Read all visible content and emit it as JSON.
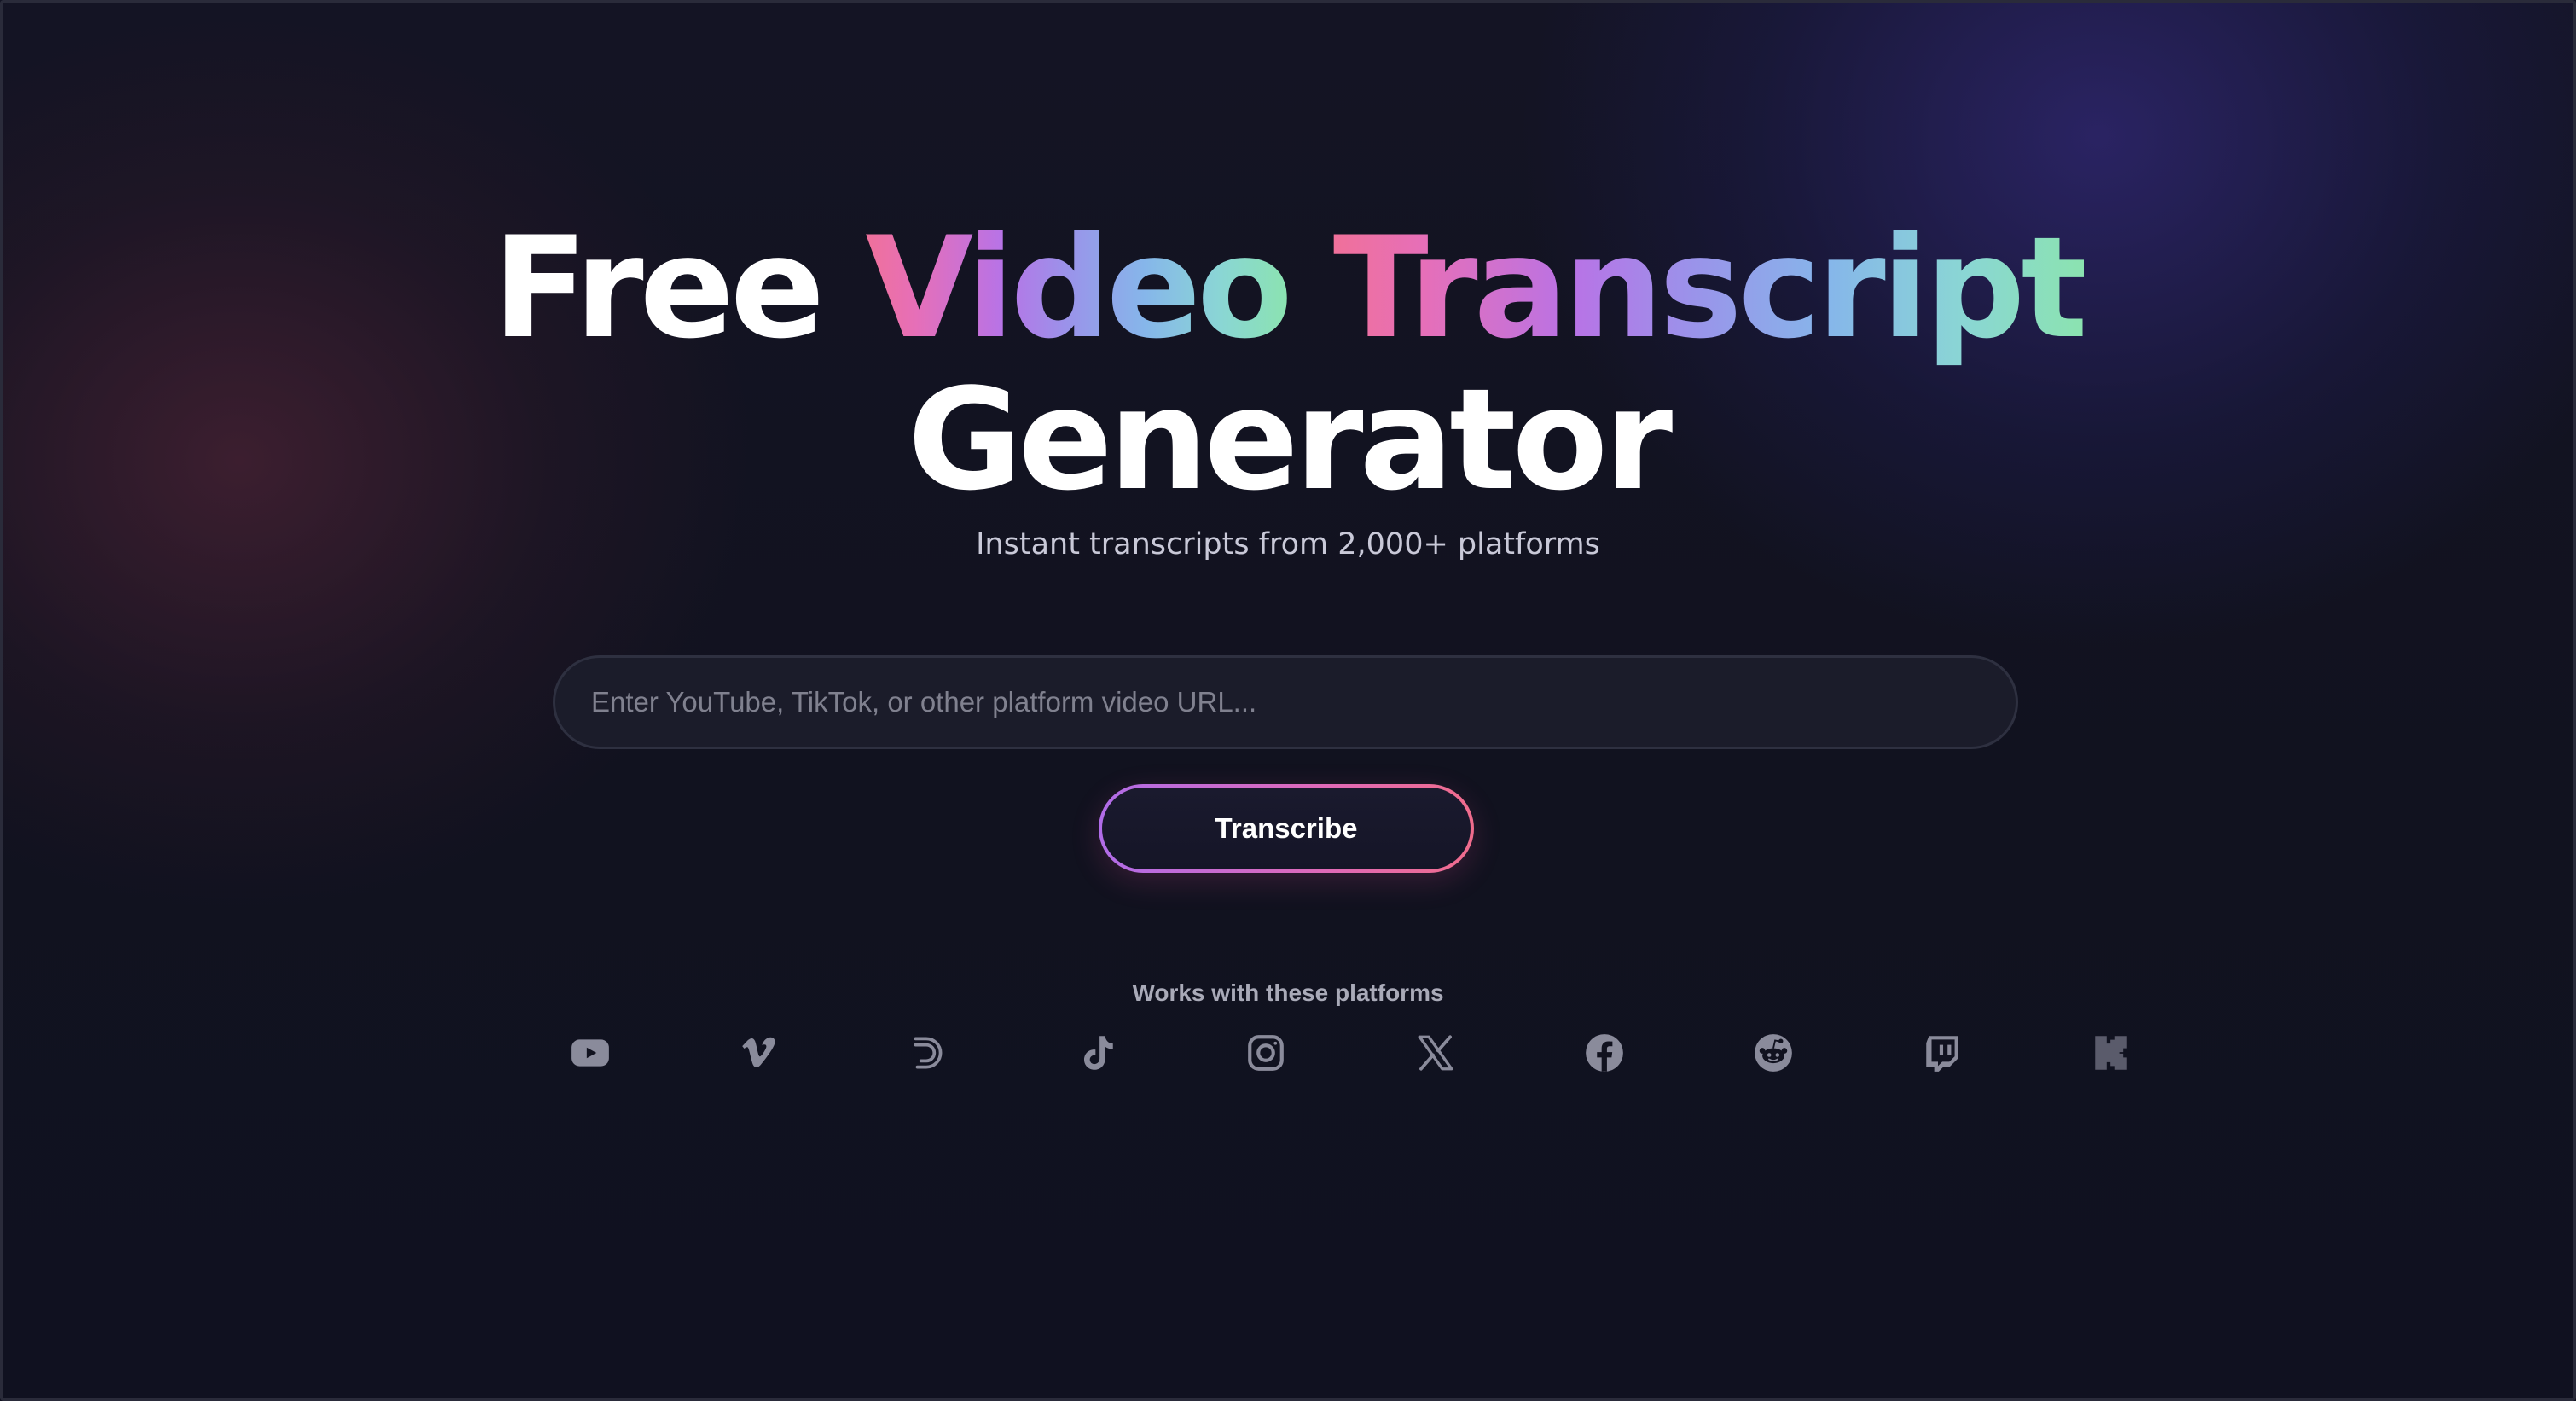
{
  "hero": {
    "title_word_1": "Free",
    "title_word_2": "Video",
    "title_word_3": "Transcript",
    "title_word_4": "Generator",
    "subtitle": "Instant transcripts from 2,000+ platforms"
  },
  "form": {
    "url_placeholder": "Enter YouTube, TikTok, or other platform video URL...",
    "url_value": "",
    "submit_label": "Transcribe"
  },
  "platforms": {
    "title": "Works with these platforms",
    "icons": [
      "youtube-icon",
      "vimeo-icon",
      "dailymotion-icon",
      "tiktok-icon",
      "instagram-icon",
      "x-icon",
      "facebook-icon",
      "reddit-icon",
      "twitch-icon",
      "kick-icon"
    ]
  },
  "colors": {
    "background": "#11121f",
    "gradient_start": "#f0709a",
    "gradient_mid": "#9a93ea",
    "gradient_end": "#8be3b0",
    "icon_color": "#8a8b9b"
  }
}
